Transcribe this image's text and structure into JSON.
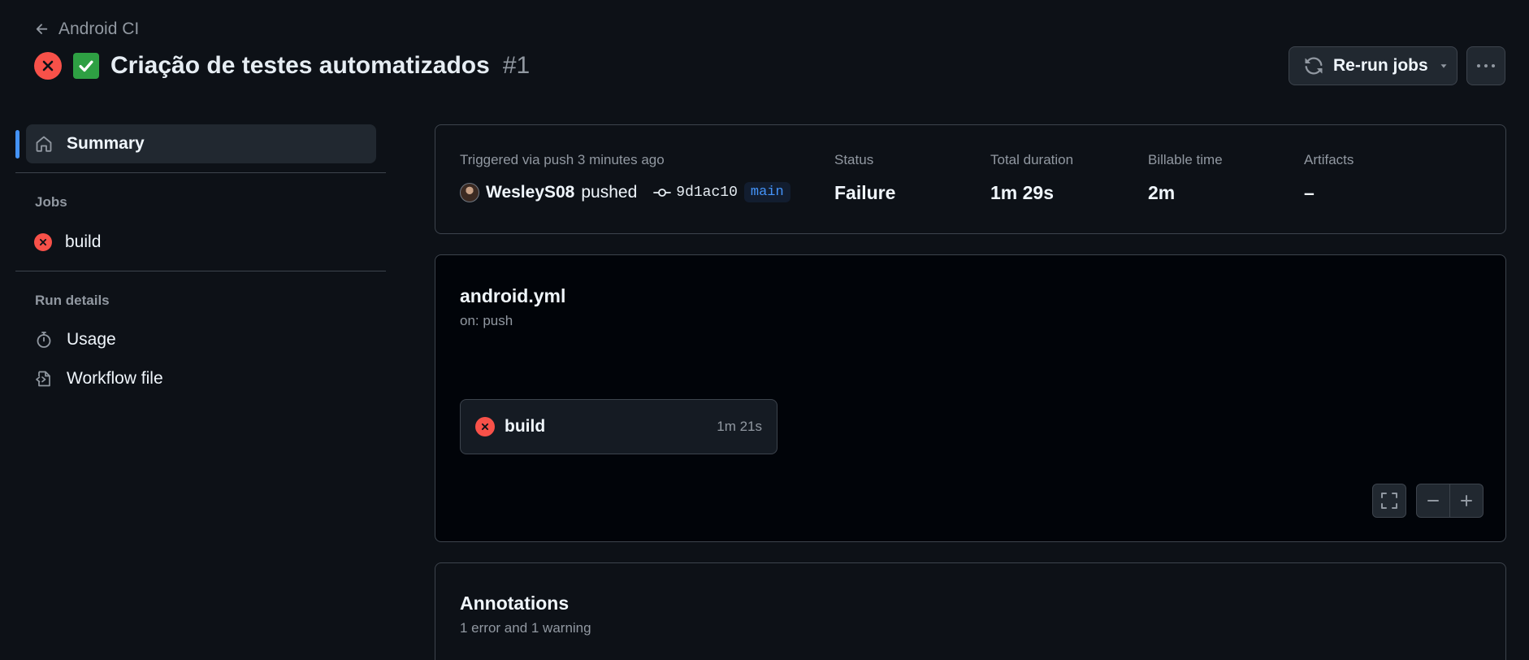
{
  "header": {
    "back_label": "Android CI",
    "title": "Criação de testes automatizados",
    "run_number": "#1",
    "rerun_label": "Re-run jobs"
  },
  "sidebar": {
    "summary_label": "Summary",
    "jobs_heading": "Jobs",
    "jobs": [
      {
        "label": "build",
        "status": "failure"
      }
    ],
    "run_details_heading": "Run details",
    "usage_label": "Usage",
    "workflow_file_label": "Workflow file"
  },
  "summary": {
    "trigger_label": "Triggered via push 3 minutes ago",
    "actor": "WesleyS08",
    "action": "pushed",
    "commit": "9d1ac10",
    "branch": "main",
    "status_label": "Status",
    "status_value": "Failure",
    "duration_label": "Total duration",
    "duration_value": "1m 29s",
    "billable_label": "Billable time",
    "billable_value": "2m",
    "artifacts_label": "Artifacts",
    "artifacts_value": "–"
  },
  "workflow": {
    "file_name": "android.yml",
    "trigger": "on: push",
    "job_name": "build",
    "job_duration": "1m 21s"
  },
  "annotations": {
    "title": "Annotations",
    "subtitle": "1 error and 1 warning"
  },
  "colors": {
    "background": "#0d1117",
    "failure": "#f85149",
    "accent": "#4493f8",
    "success_emoji": "#2ea043"
  }
}
